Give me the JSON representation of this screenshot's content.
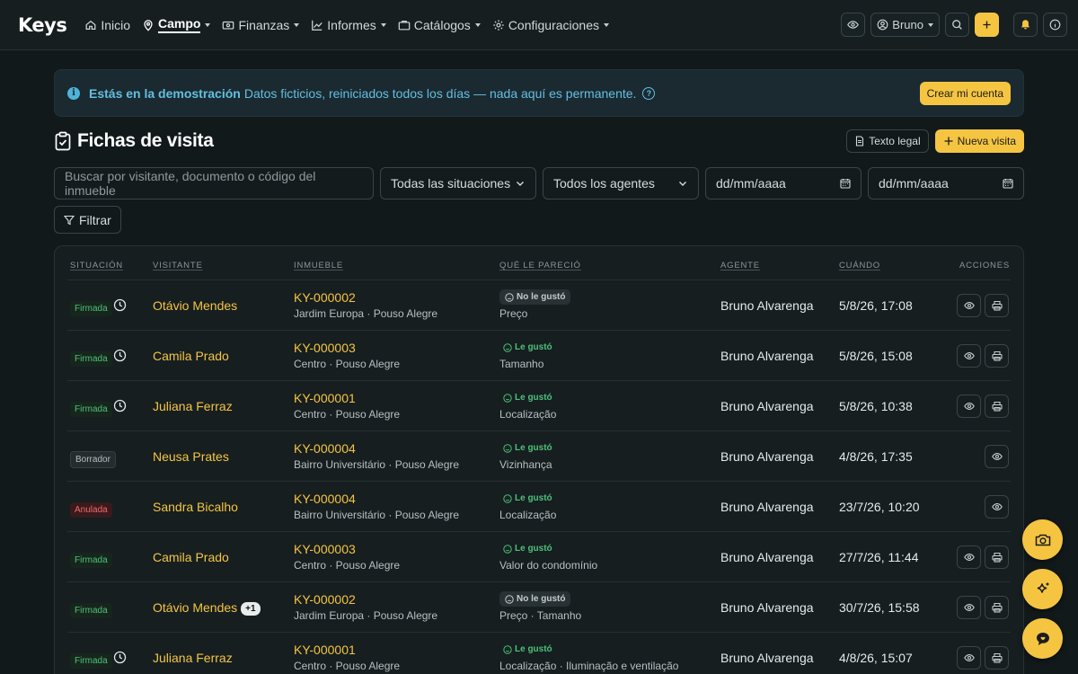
{
  "app": {
    "logo": "Keys"
  },
  "nav": {
    "items": [
      {
        "label": "Inicio",
        "icon": "home-icon",
        "active": false,
        "dropdown": false
      },
      {
        "label": "Campo",
        "icon": "map-pin-icon",
        "active": true,
        "dropdown": true
      },
      {
        "label": "Finanzas",
        "icon": "cash-icon",
        "active": false,
        "dropdown": true
      },
      {
        "label": "Informes",
        "icon": "chart-line-icon",
        "active": false,
        "dropdown": true
      },
      {
        "label": "Catálogos",
        "icon": "briefcase-icon",
        "active": false,
        "dropdown": true
      },
      {
        "label": "Configuraciones",
        "icon": "gear-icon",
        "active": false,
        "dropdown": true
      }
    ],
    "user": "Bruno"
  },
  "banner": {
    "title": "Estás en la demostración",
    "text": "Datos ficticios, reiniciados todos los días — nada aquí es permanente.",
    "cta": "Crear mi cuenta"
  },
  "page": {
    "title": "Fichas de visita",
    "legal_label": "Texto legal",
    "new_label": "Nueva visita"
  },
  "filters": {
    "search_placeholder": "Buscar por visitante, documento o código del inmueble",
    "situation": "Todas las situaciones",
    "agent": "Todos los agentes",
    "date_from": "dd/mm/aaaa",
    "date_to": "dd/mm/aaaa",
    "filter_label": "Filtrar"
  },
  "table": {
    "headers": {
      "situation": "Situación",
      "visitor": "Visitante",
      "property": "Inmueble",
      "reaction": "Qué le pareció",
      "agent": "Agente",
      "when": "Cuándo",
      "actions": "Acciones"
    },
    "rows": [
      {
        "status": "Firmada",
        "status_kind": "firmada",
        "clock": true,
        "visitor": "Otávio Mendes",
        "extra": "",
        "code": "KY-000002",
        "address": "Jardim Europa · Pouso Alegre",
        "reaction": "No le gustó",
        "reaction_kind": "dislike",
        "reason": "Preço",
        "agent": "Bruno Alvarenga",
        "when": "5/8/26, 17:08",
        "print": true
      },
      {
        "status": "Firmada",
        "status_kind": "firmada",
        "clock": true,
        "visitor": "Camila Prado",
        "extra": "",
        "code": "KY-000003",
        "address": "Centro · Pouso Alegre",
        "reaction": "Le gustó",
        "reaction_kind": "like",
        "reason": "Tamanho",
        "agent": "Bruno Alvarenga",
        "when": "5/8/26, 15:08",
        "print": true
      },
      {
        "status": "Firmada",
        "status_kind": "firmada",
        "clock": true,
        "visitor": "Juliana Ferraz",
        "extra": "",
        "code": "KY-000001",
        "address": "Centro · Pouso Alegre",
        "reaction": "Le gustó",
        "reaction_kind": "like",
        "reason": "Localização",
        "agent": "Bruno Alvarenga",
        "when": "5/8/26, 10:38",
        "print": true
      },
      {
        "status": "Borrador",
        "status_kind": "borrador",
        "clock": false,
        "visitor": "Neusa Prates",
        "extra": "",
        "code": "KY-000004",
        "address": "Bairro Universitário · Pouso Alegre",
        "reaction": "Le gustó",
        "reaction_kind": "like",
        "reason": "Vizinhança",
        "agent": "Bruno Alvarenga",
        "when": "4/8/26, 17:35",
        "print": false
      },
      {
        "status": "Anulada",
        "status_kind": "anulada",
        "clock": false,
        "visitor": "Sandra Bicalho",
        "extra": "",
        "code": "KY-000004",
        "address": "Bairro Universitário · Pouso Alegre",
        "reaction": "Le gustó",
        "reaction_kind": "like",
        "reason": "Localização",
        "agent": "Bruno Alvarenga",
        "when": "23/7/26, 10:20",
        "print": false
      },
      {
        "status": "Firmada",
        "status_kind": "firmada",
        "clock": false,
        "visitor": "Camila Prado",
        "extra": "",
        "code": "KY-000003",
        "address": "Centro · Pouso Alegre",
        "reaction": "Le gustó",
        "reaction_kind": "like",
        "reason": "Valor do condomínio",
        "agent": "Bruno Alvarenga",
        "when": "27/7/26, 11:44",
        "print": true
      },
      {
        "status": "Firmada",
        "status_kind": "firmada",
        "clock": false,
        "visitor": "Otávio Mendes",
        "extra": "+1",
        "code": "KY-000002",
        "address": "Jardim Europa · Pouso Alegre",
        "reaction": "No le gustó",
        "reaction_kind": "dislike",
        "reason": "Preço · Tamanho",
        "agent": "Bruno Alvarenga",
        "when": "30/7/26, 15:58",
        "print": true
      },
      {
        "status": "Firmada",
        "status_kind": "firmada",
        "clock": true,
        "visitor": "Juliana Ferraz",
        "extra": "",
        "code": "KY-000001",
        "address": "Centro · Pouso Alegre",
        "reaction": "Le gustó",
        "reaction_kind": "like",
        "reason": "Localização · Iluminação e ventilação",
        "agent": "Bruno Alvarenga",
        "when": "4/8/26, 15:07",
        "print": true
      }
    ]
  },
  "fabs": [
    "camera-icon",
    "sparkle-icon",
    "chat-icon"
  ]
}
